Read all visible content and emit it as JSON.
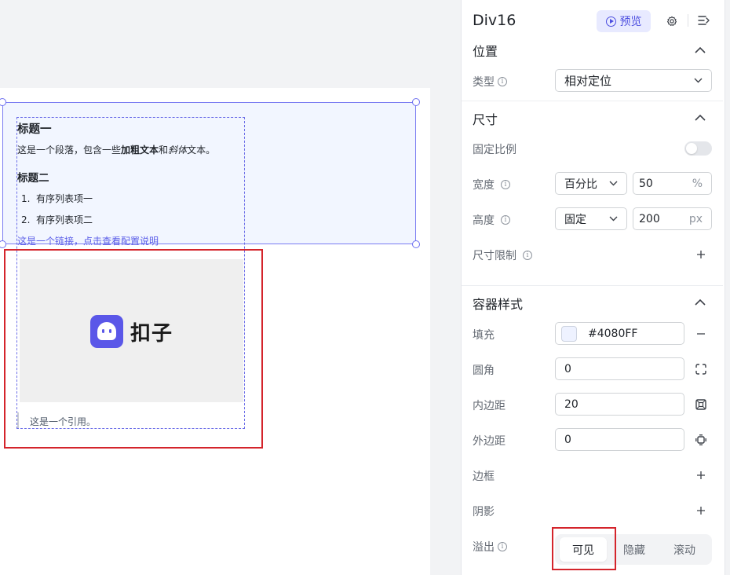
{
  "canvas": {
    "heading1": "标题一",
    "paragraph": {
      "prefix": "这是一个段落，包含一些",
      "bold": "加粗文本",
      "middle": "和",
      "italic": "斜体",
      "suffix": "文本。"
    },
    "heading2": "标题二",
    "ordered_list": [
      {
        "num": "1.",
        "text": "有序列表项一"
      },
      {
        "num": "2.",
        "text": "有序列表项二"
      }
    ],
    "link_text": "这是一个链接，点击查看配置说明",
    "image_logo_text": "扣子",
    "quote": "这是一个引用。"
  },
  "panel": {
    "title": "Div16",
    "preview_label": "预览",
    "icons": {
      "settings": "gear-icon",
      "collapse": "collapse-panel-icon"
    },
    "position": {
      "title": "位置",
      "type_label": "类型",
      "type_value": "相对定位"
    },
    "size": {
      "title": "尺寸",
      "fixed_ratio_label": "固定比例",
      "fixed_ratio_on": false,
      "width_label": "宽度",
      "width_mode": "百分比",
      "width_value": "50",
      "width_unit": "%",
      "height_label": "高度",
      "height_mode": "固定",
      "height_value": "200",
      "height_unit": "px",
      "limit_label": "尺寸限制"
    },
    "container_style": {
      "title": "容器样式",
      "fill_label": "填充",
      "fill_value": "#4080FF",
      "radius_label": "圆角",
      "radius_value": "0",
      "padding_label": "内边距",
      "padding_value": "20",
      "margin_label": "外边距",
      "margin_value": "0",
      "border_label": "边框",
      "shadow_label": "阴影",
      "overflow_label": "溢出",
      "overflow_options": [
        "可见",
        "隐藏",
        "滚动"
      ],
      "overflow_selected": "可见"
    }
  },
  "colors": {
    "accent": "#4d4fe0",
    "selection": "#7a7cf2",
    "highlight_red": "#d4242b"
  }
}
